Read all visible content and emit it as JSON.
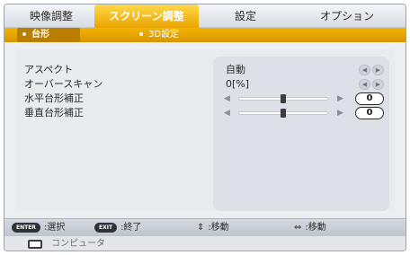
{
  "tabs": [
    "映像調整",
    "スクリーン調整",
    "設定",
    "オプション"
  ],
  "subtabs": [
    "台形",
    "3D設定"
  ],
  "rows": [
    {
      "label": "アスペクト",
      "value": "自動",
      "control": "pill"
    },
    {
      "label": "オーバースキャン",
      "value": "0[%]",
      "control": "pill"
    },
    {
      "label": "水平台形補正",
      "value": "0",
      "control": "slider",
      "level": 0.5
    },
    {
      "label": "垂直台形補正",
      "value": "0",
      "control": "slider",
      "level": 0.5
    }
  ],
  "footer": {
    "hints": [
      {
        "key": "ENTER",
        "label": ":選択"
      },
      {
        "key": "EXIT",
        "label": ":終了"
      },
      {
        "key": "⇕",
        "label": ":移動"
      },
      {
        "key": "⇔",
        "label": ":移動"
      }
    ]
  },
  "source": {
    "label": "コンピュータ"
  },
  "colors": {
    "accent": "#e8a400",
    "panel": "#eceef2"
  }
}
